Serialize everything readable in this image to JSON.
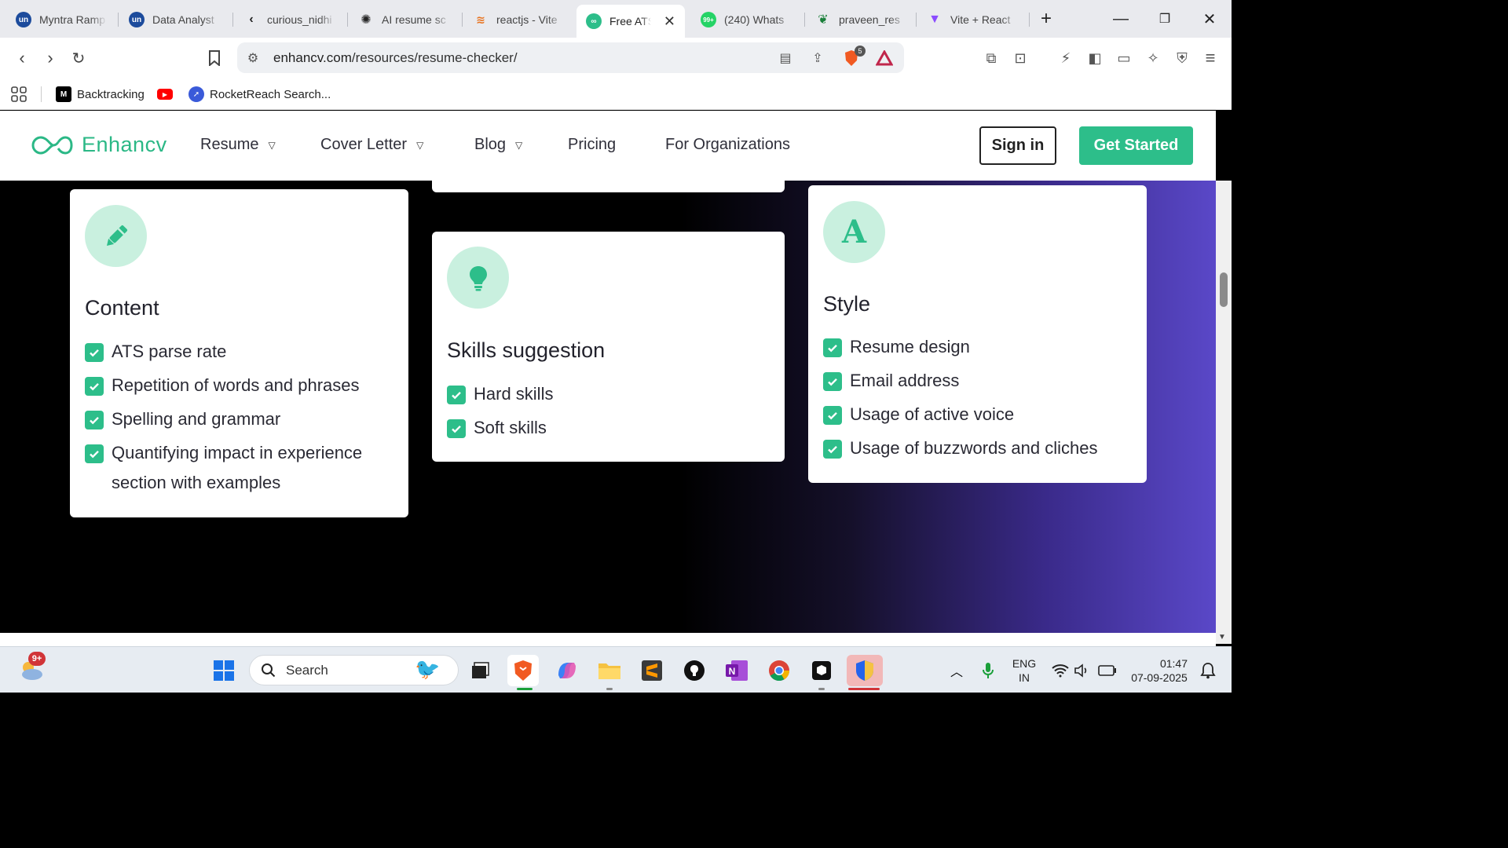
{
  "browser": {
    "tabs": [
      {
        "title": "Myntra Ramp",
        "favicon": "unstop-icon",
        "active": false
      },
      {
        "title": "Data Analyst",
        "favicon": "unstop-icon",
        "active": false
      },
      {
        "title": "curious_nidhi",
        "favicon": "leetcode-icon",
        "active": false
      },
      {
        "title": "AI resume sc",
        "favicon": "openai-icon",
        "active": false
      },
      {
        "title": "reactjs - Vite",
        "favicon": "stackoverflow-icon",
        "active": false
      },
      {
        "title": "Free ATS",
        "favicon": "enhancv-icon",
        "active": true
      },
      {
        "title": "(240) Whats",
        "favicon": "whatsapp-icon",
        "active": false
      },
      {
        "title": "praveen_res",
        "favicon": "overleaf-icon",
        "active": false
      },
      {
        "title": "Vite + React",
        "favicon": "vite-icon",
        "active": false
      }
    ],
    "new_tab": "+",
    "url_domain": "enhancv.com",
    "url_path": "/resources/resume-checker/",
    "brave_shield_count": "5",
    "bookmarks": [
      {
        "label": "Backtracking",
        "favicon": "medium-icon"
      },
      {
        "label": "",
        "favicon": "youtube-icon"
      },
      {
        "label": "RocketReach Search...",
        "favicon": "rocketreach-icon"
      }
    ]
  },
  "site": {
    "logo_text": "Enhancv",
    "nav": [
      {
        "label": "Resume",
        "dropdown": true
      },
      {
        "label": "Cover Letter",
        "dropdown": true
      },
      {
        "label": "Blog",
        "dropdown": true
      },
      {
        "label": "Pricing",
        "dropdown": false
      },
      {
        "label": "For Organizations",
        "dropdown": false
      }
    ],
    "sign_in": "Sign in",
    "get_started": "Get Started",
    "accent_color": "#2dbe8a"
  },
  "cards": [
    {
      "title": "Content",
      "icon": "pencil-icon",
      "items": [
        "ATS parse rate",
        "Repetition of words and phrases",
        "Spelling and grammar",
        "Quantifying impact in experience section with examples"
      ]
    },
    {
      "title": "Skills suggestion",
      "icon": "lightbulb-icon",
      "items": [
        "Hard skills",
        "Soft skills"
      ]
    },
    {
      "title": "Style",
      "icon": "letter-a-icon",
      "icon_glyph": "A",
      "items": [
        "Resume design",
        "Email address",
        "Usage of active voice",
        "Usage of buzzwords and cliches"
      ]
    }
  ],
  "taskbar": {
    "weather_badge": "9+",
    "search_placeholder": "Search",
    "language_line1": "ENG",
    "language_line2": "IN",
    "time": "01:47",
    "date": "07-09-2025"
  }
}
